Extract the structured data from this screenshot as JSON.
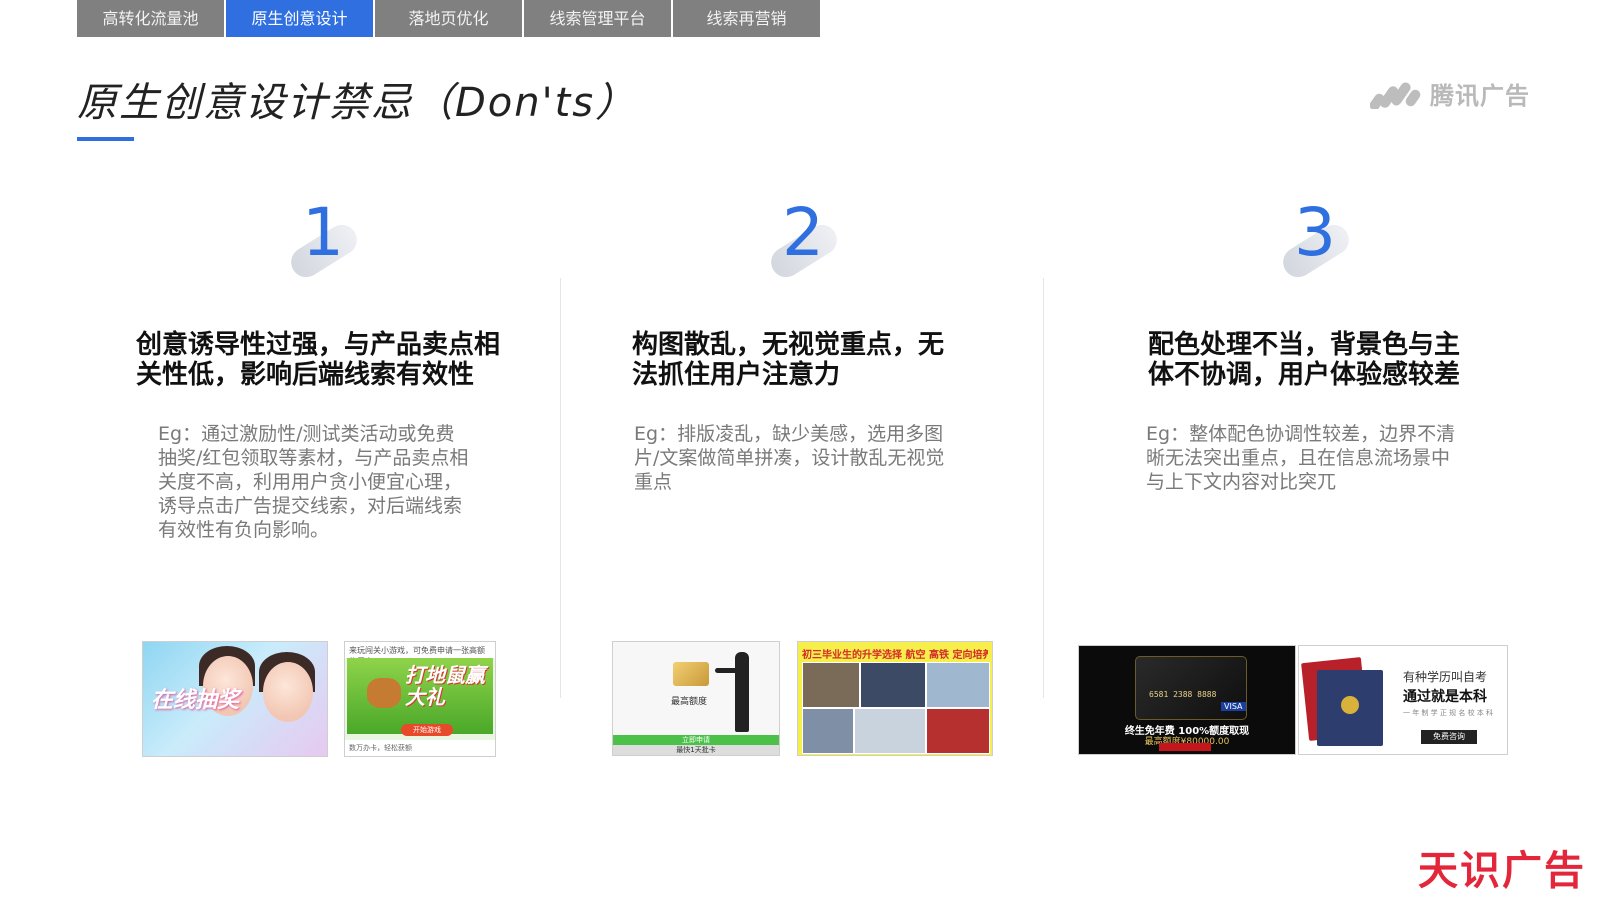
{
  "nav": {
    "tabs": [
      {
        "label": "高转化流量池",
        "active": false
      },
      {
        "label": "原生创意设计",
        "active": true
      },
      {
        "label": "落地页优化",
        "active": false
      },
      {
        "label": "线索管理平台",
        "active": false
      },
      {
        "label": "线索再营销",
        "active": false
      }
    ]
  },
  "header": {
    "title": "原生创意设计禁忌（Don'ts）",
    "brand": "腾讯广告"
  },
  "colors": {
    "accent": "#2f6fe0",
    "tab_inactive": "#808080",
    "watermark": "#e3263a"
  },
  "columns": [
    {
      "number": "1",
      "heading_lines": [
        "创意诱导性过强，与产品卖点相",
        "关性低，影响后端线索有效性"
      ],
      "desc_lines": [
        "Eg：通过激励性/测试类活动或免费",
        "抽奖/红包领取等素材，与产品卖点相",
        "关度不高，利用用户贪小便宜心理，",
        "诱导点击广告提交线索，对后端线索",
        "有效性有负向影响。"
      ],
      "thumbs": [
        {
          "text": "在线抽奖"
        },
        {
          "top": "来玩闯关小游戏，可免费申请一张高额信用卡!",
          "text": "打地鼠赢大礼",
          "button": "开始游戏",
          "foot": "数万办卡，轻松获额"
        }
      ]
    },
    {
      "number": "2",
      "heading_lines": [
        "构图散乱，无视觉重点，无",
        "法抓住用户注意力"
      ],
      "desc_lines": [
        "Eg：排版凌乱，缺少美感，选用多图",
        "片/文案做简单拼凑，设计散乱无视觉",
        "重点"
      ],
      "thumbs": [
        {
          "caption": "最高额度",
          "bar1": "立即申请",
          "bar2": "最快1天批卡"
        },
        {
          "text": "初三毕业生的升学选择 航空 高铁 定向培养"
        }
      ]
    },
    {
      "number": "3",
      "heading_lines": [
        "配色处理不当，背景色与主",
        "体不协调，用户体验感较差"
      ],
      "desc_lines": [
        "Eg：整体配色协调性较差，边界不清",
        "晰无法突出重点，且在信息流场景中",
        "与上下文内容对比突兀"
      ],
      "thumbs": [
        {
          "card_number": "6581 2388 8888",
          "visa": "VISA",
          "line1": "终生免年费 100%额度取现",
          "line2": "最高额度¥80000.00"
        },
        {
          "q": "有种学历叫自考",
          "a": "通过就是本科",
          "small": "一 年 制 学 正 规 名 校 本 科",
          "button": "免费咨询"
        }
      ]
    }
  ],
  "watermark": "天识广告"
}
